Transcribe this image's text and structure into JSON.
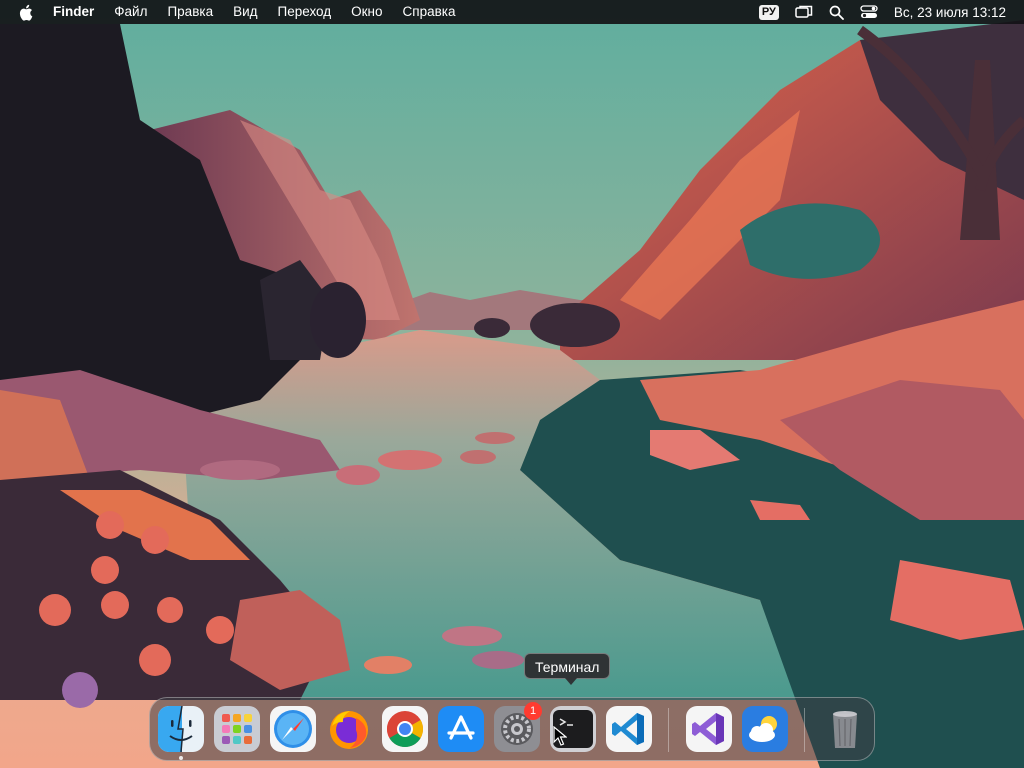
{
  "menubar": {
    "apple_icon": "apple-logo-icon",
    "app_name": "Finder",
    "menus": [
      "Файл",
      "Правка",
      "Вид",
      "Переход",
      "Окно",
      "Справка"
    ],
    "input_language": "РУ",
    "status_icons": [
      "screen-mirroring-icon",
      "spotlight-search-icon",
      "control-center-icon"
    ],
    "clock": "Вс, 23 июля  13:12"
  },
  "dock": {
    "items": [
      {
        "name": "Finder",
        "icon": "finder-icon",
        "running": true
      },
      {
        "name": "Launchpad",
        "icon": "launchpad-icon",
        "running": false
      },
      {
        "name": "Safari",
        "icon": "safari-icon",
        "running": false
      },
      {
        "name": "Firefox",
        "icon": "firefox-icon",
        "running": false
      },
      {
        "name": "Google Chrome",
        "icon": "chrome-icon",
        "running": false
      },
      {
        "name": "App Store",
        "icon": "app-store-icon",
        "running": false
      },
      {
        "name": "System Settings",
        "icon": "system-settings-icon",
        "running": false,
        "badge": "1"
      },
      {
        "name": "Терминал",
        "icon": "terminal-icon",
        "running": false
      },
      {
        "name": "Visual Studio Code",
        "icon": "vscode-icon",
        "running": false
      },
      {
        "name": "Visual Studio",
        "icon": "visual-studio-icon",
        "running": false
      },
      {
        "name": "Weather",
        "icon": "weather-icon",
        "running": false
      },
      {
        "name": "Trash",
        "icon": "trash-icon",
        "running": false
      }
    ],
    "tooltip": "Терминал"
  },
  "colors": {
    "menubar_bg": "#121216",
    "sky_top": "#5fae9e",
    "sky_horizon": "#f2a68a",
    "water": "#4f9a8e",
    "cliff_coral": "#e86a4e",
    "rock_purple": "#8a4a62",
    "badge_red": "#ff3b30"
  }
}
